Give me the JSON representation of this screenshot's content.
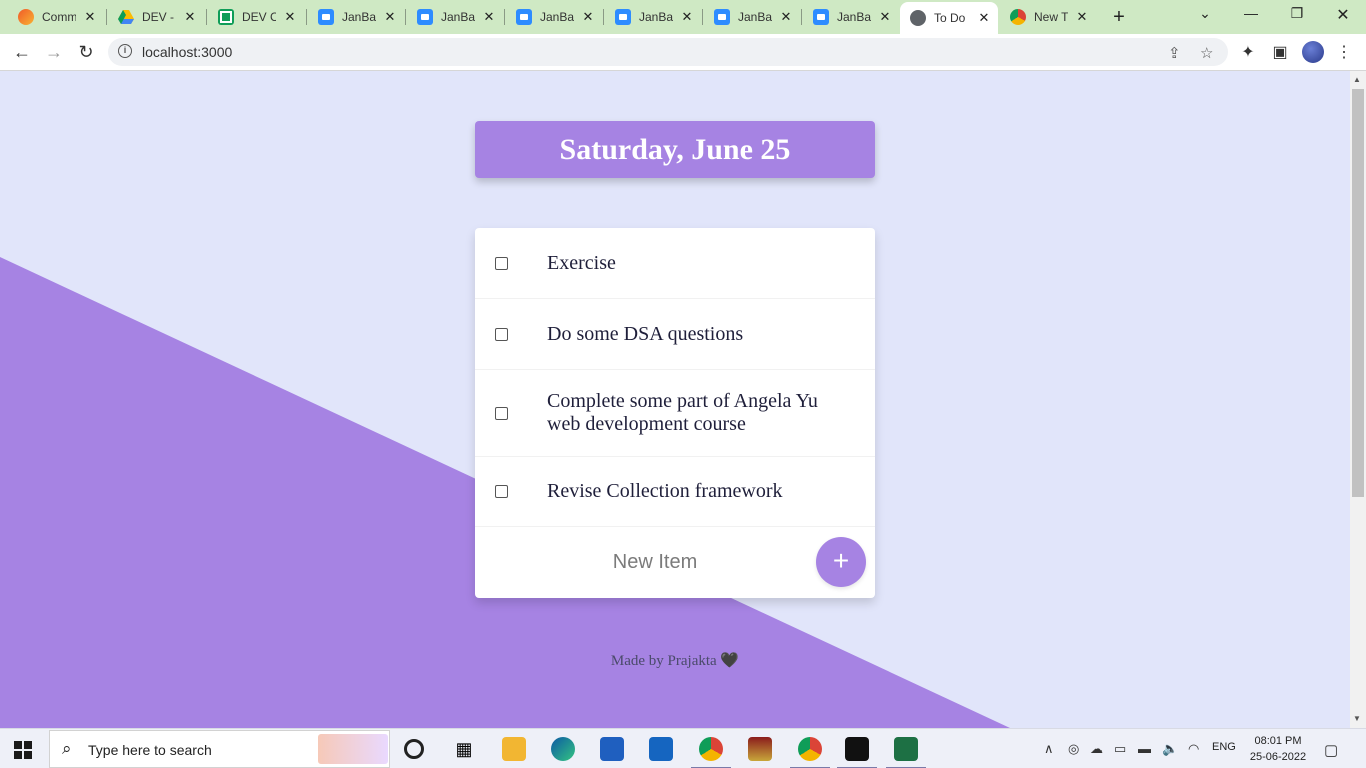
{
  "browser": {
    "tabs": [
      {
        "title": "Comm",
        "icon": "comm-icon",
        "active": false
      },
      {
        "title": "DEV -",
        "icon": "drive-icon",
        "active": false
      },
      {
        "title": "DEV Cl",
        "icon": "sheets-icon",
        "active": false
      },
      {
        "title": "JanBat",
        "icon": "zoom-icon",
        "active": false
      },
      {
        "title": "JanBat",
        "icon": "zoom-icon",
        "active": false
      },
      {
        "title": "JanBat",
        "icon": "zoom-icon",
        "active": false
      },
      {
        "title": "JanBat",
        "icon": "zoom-icon",
        "active": false
      },
      {
        "title": "JanBat",
        "icon": "zoom-icon",
        "active": false
      },
      {
        "title": "JanBat",
        "icon": "zoom-icon",
        "active": false
      },
      {
        "title": "To Do",
        "icon": "globe-icon",
        "active": true
      },
      {
        "title": "New T",
        "icon": "chrome-icon",
        "active": false
      }
    ],
    "url": "localhost:3000"
  },
  "page": {
    "date_title": "Saturday, June 25",
    "items": [
      {
        "text": "Exercise",
        "checked": false
      },
      {
        "text": "Do some DSA questions",
        "checked": false
      },
      {
        "text": "Complete some part of Angela Yu web development course",
        "checked": false
      },
      {
        "text": "Revise Collection framework",
        "checked": false
      }
    ],
    "new_item_placeholder": "New Item",
    "add_button_label": "+",
    "footer": "Made by Prajakta 🖤",
    "colors": {
      "accent": "#a683e3",
      "background": "#e1e5fa",
      "card": "#ffffff"
    }
  },
  "taskbar": {
    "search_placeholder": "Type here to search",
    "language": "ENG",
    "time": "08:01 PM",
    "date": "25-06-2022"
  }
}
